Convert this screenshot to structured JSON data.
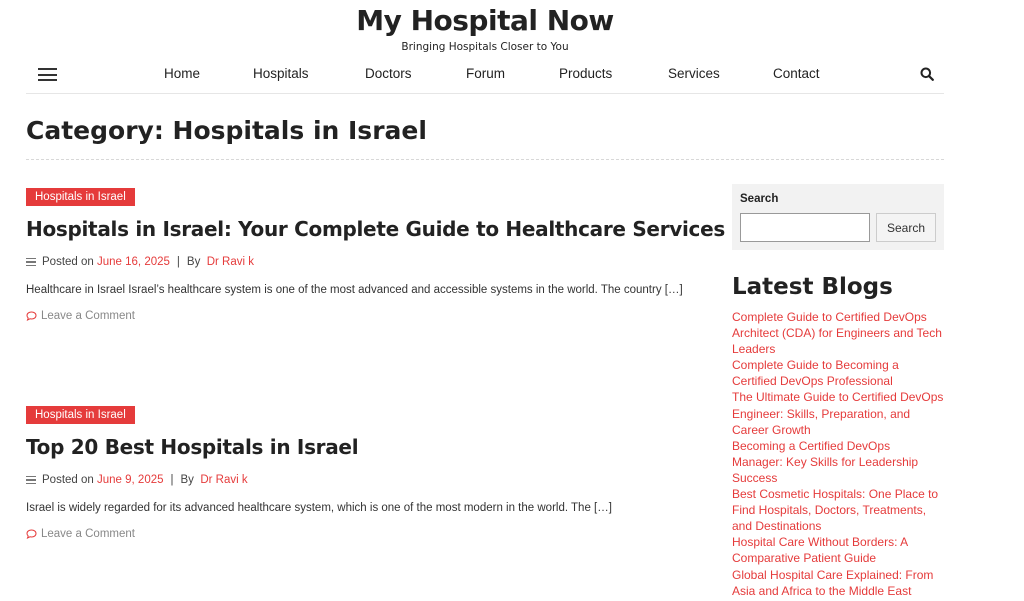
{
  "site": {
    "title": "My Hospital Now",
    "tagline": "Bringing Hospitals Closer to You"
  },
  "nav": {
    "items": [
      "Home",
      "Hospitals",
      "Doctors",
      "Forum",
      "Products",
      "Services",
      "Contact"
    ]
  },
  "page": {
    "category_title": "Category: Hospitals in Israel"
  },
  "posts": [
    {
      "category": "Hospitals in Israel",
      "title": "Hospitals in Israel: Your Complete Guide to Healthcare Services",
      "posted_label": "Posted on",
      "date": "June 16, 2025",
      "separator": "|",
      "by_label": "By",
      "author": "Dr Ravi k",
      "excerpt": "Healthcare in Israel Israel’s healthcare system is one of the most advanced and accessible systems in the world. The country […]",
      "comment_label": "Leave a Comment"
    },
    {
      "category": "Hospitals in Israel",
      "title": "Top 20 Best Hospitals in Israel",
      "posted_label": "Posted on",
      "date": "June 9, 2025",
      "separator": "|",
      "by_label": "By",
      "author": "Dr Ravi k",
      "excerpt": "Israel is widely regarded for its advanced healthcare system, which is one of the most modern in the world. The […]",
      "comment_label": "Leave a Comment"
    }
  ],
  "sidebar": {
    "search_label": "Search",
    "search_value": "",
    "search_button": "Search",
    "latest_heading": "Latest Blogs",
    "latest_items": [
      "Complete Guide to Certified DevOps Architect (CDA) for Engineers and Tech Leaders",
      "Complete Guide to Becoming a Certified DevOps Professional",
      "The Ultimate Guide to Certified DevOps Engineer: Skills, Preparation, and Career Growth",
      "Becoming a Certified DevOps Manager: Key Skills for Leadership Success",
      "Best Cosmetic Hospitals: One Place to Find Hospitals, Doctors, Treatments, and Destinations",
      "Hospital Care Without Borders: A Comparative Patient Guide",
      "Global Hospital Care Explained: From Asia and Africa to the Middle East"
    ]
  },
  "colors": {
    "accent": "#e53b3b",
    "text": "#222222",
    "muted": "#888888",
    "widget_bg": "#f2f2f2"
  },
  "icons": {
    "menu": "hamburger-icon",
    "search": "search-icon",
    "meta": "list-icon",
    "comment": "comment-icon"
  }
}
